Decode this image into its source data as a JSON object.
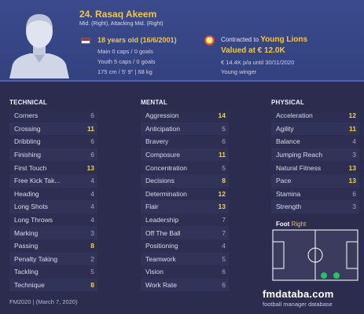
{
  "header": {
    "name": "24. Rasaq Akeem",
    "positions": "Mid. (Right), Attacking Mid. (Right)",
    "age": "18 years old (16/6/2001)",
    "main_caps": "Main 0 caps / 0 goals",
    "youth_caps": "Youth 5 caps / 0 goals",
    "height_weight": "175 cm / 5' 9\" | 68 kg",
    "contract_prefix": "Contracted to ",
    "club": "Young Lions",
    "value": "Valued at € 12.0K",
    "wage": "€ 14.4K p/a until 30/11/2020",
    "role": "Young winger",
    "flag_colors": [
      "#e8112d",
      "#ffffff"
    ],
    "club_badge_icon": "lion-crest-icon"
  },
  "technical": {
    "title": "TECHNICAL",
    "attributes": [
      {
        "name": "Corners",
        "value": "6"
      },
      {
        "name": "Crossing",
        "value": "11"
      },
      {
        "name": "Dribbling",
        "value": "6"
      },
      {
        "name": "Finishing",
        "value": "6"
      },
      {
        "name": "First Touch",
        "value": "13"
      },
      {
        "name": "Free Kick Tak...",
        "value": "4"
      },
      {
        "name": "Heading",
        "value": "4"
      },
      {
        "name": "Long Shots",
        "value": "4"
      },
      {
        "name": "Long Throws",
        "value": "4"
      },
      {
        "name": "Marking",
        "value": "3"
      },
      {
        "name": "Passing",
        "value": "8"
      },
      {
        "name": "Penalty Taking",
        "value": "2"
      },
      {
        "name": "Tackling",
        "value": "5"
      },
      {
        "name": "Technique",
        "value": "8"
      }
    ]
  },
  "mental": {
    "title": "MENTAL",
    "attributes": [
      {
        "name": "Aggression",
        "value": "14"
      },
      {
        "name": "Anticipation",
        "value": "5"
      },
      {
        "name": "Bravery",
        "value": "6"
      },
      {
        "name": "Composure",
        "value": "11"
      },
      {
        "name": "Concentration",
        "value": "5"
      },
      {
        "name": "Decisions",
        "value": "8"
      },
      {
        "name": "Determination",
        "value": "12"
      },
      {
        "name": "Flair",
        "value": "13"
      },
      {
        "name": "Leadership",
        "value": "7"
      },
      {
        "name": "Off The Ball",
        "value": "7"
      },
      {
        "name": "Positioning",
        "value": "4"
      },
      {
        "name": "Teamwork",
        "value": "5"
      },
      {
        "name": "Vision",
        "value": "6"
      },
      {
        "name": "Work Rate",
        "value": "6"
      }
    ]
  },
  "physical": {
    "title": "PHYSICAL",
    "attributes": [
      {
        "name": "Acceleration",
        "value": "12"
      },
      {
        "name": "Agility",
        "value": "11"
      },
      {
        "name": "Balance",
        "value": "4"
      },
      {
        "name": "Jumping Reach",
        "value": "3"
      },
      {
        "name": "Natural Fitness",
        "value": "13"
      },
      {
        "name": "Pace",
        "value": "13"
      },
      {
        "name": "Stamina",
        "value": "6"
      },
      {
        "name": "Strength",
        "value": "3"
      }
    ]
  },
  "foot": {
    "label": "Foot",
    "side": "Right"
  },
  "footer": {
    "version": "FM2020 | (March 7, 2020)",
    "brand": "fmdataba.com",
    "brand_sub": "football manager database"
  },
  "colors": {
    "highlight": "#f2d53c",
    "normal_value": "#a7a9c3",
    "header_bg": "#3a4a8c",
    "page_bg": "#2b2c4e",
    "position_dot": "#22c55e"
  }
}
